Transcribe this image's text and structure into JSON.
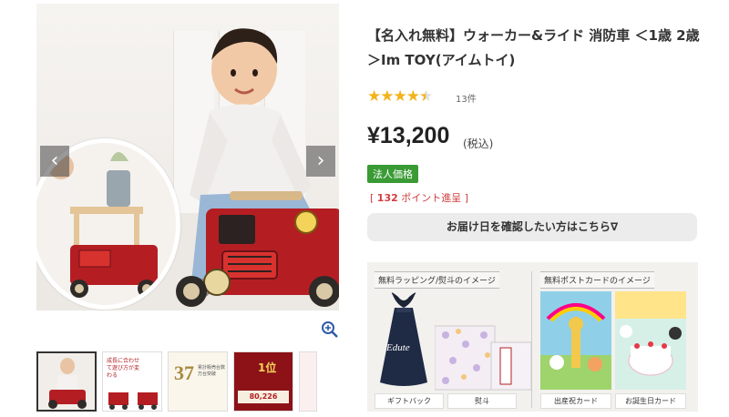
{
  "product": {
    "title": "【名入れ無料】ウォーカー&ライド 消防車 ＜1歳 2歳 ＞Im TOY(アイムトイ)",
    "rating": 4.5,
    "review_count": "13件",
    "price": "¥13,200",
    "tax_note": "(税込)",
    "corp_badge": "法人価格",
    "points_prefix": "[ ",
    "points_value": "132",
    "points_suffix": " ポイント進呈 ]",
    "delivery_button": "お届け日を確認したい方はこちら∇"
  },
  "gallery": {
    "prev_icon": "chevron-left-icon",
    "next_icon": "chevron-right-icon",
    "zoom_icon": "zoom-in-icon",
    "thumbnail_count": 6,
    "thumb_texts": {
      "t2": "成長に合わせて遊び方が変わる",
      "t3_num": "37",
      "t3_label": "累計販売台数 万台突破",
      "t4_num": "80,226",
      "t4_label": "1位"
    }
  },
  "banner": {
    "wrapping_title": "無料ラッピング/熨斗のイメージ",
    "postcard_title": "無料ポストカードのイメージ",
    "bag_text": "Edute",
    "caption_gift_bag": "ギフトバック",
    "caption_noshi": "熨斗",
    "caption_birth": "出産祝カード",
    "caption_birthday": "お誕生日カード"
  },
  "colors": {
    "star": "#f2b31b",
    "badge_green": "#3a9b35",
    "points_red": "#d03d3d",
    "truck_red": "#b41e23"
  }
}
